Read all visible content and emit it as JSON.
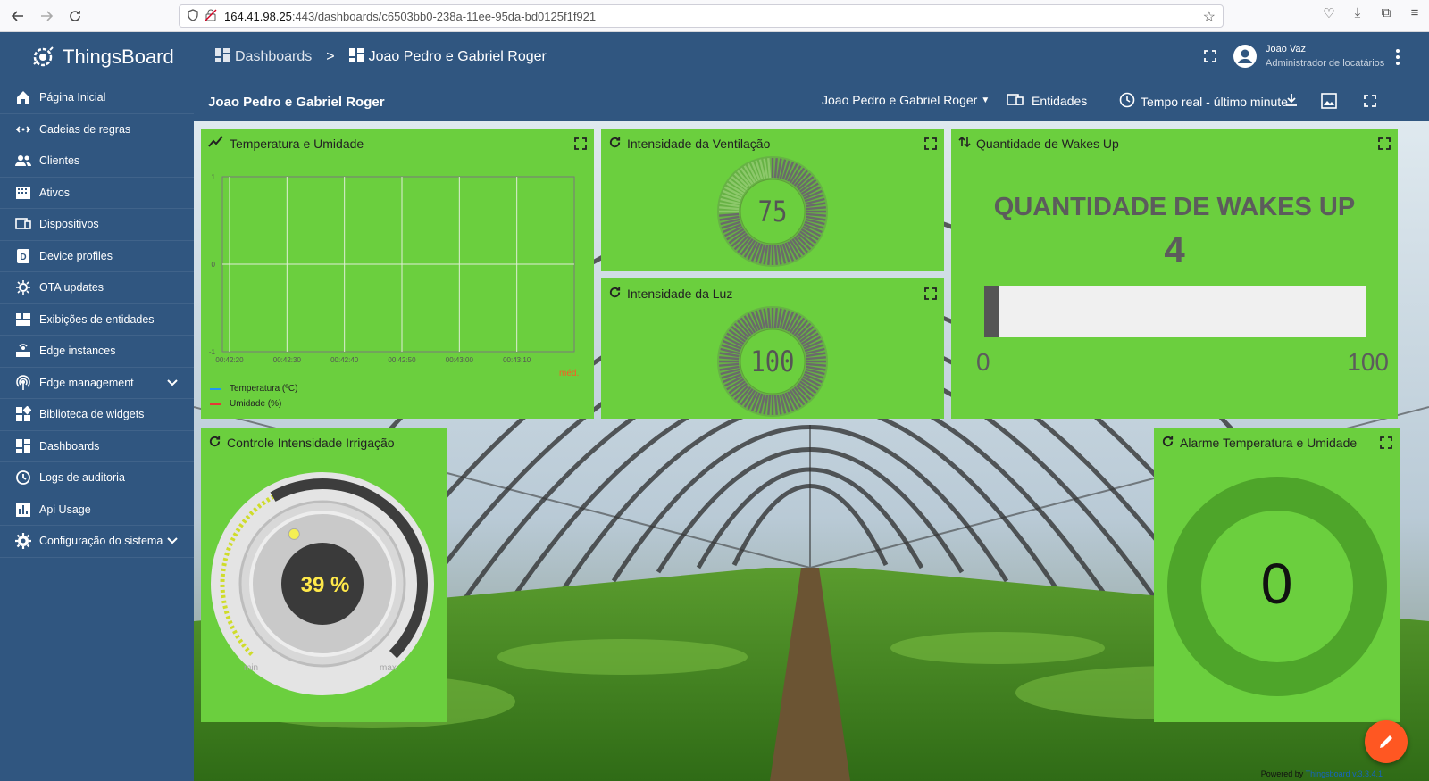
{
  "browser": {
    "url_host": "164.41.98.25",
    "url_rest": ":443/dashboards/c6503bb0-238a-11ee-95da-bd0125f1f921"
  },
  "app": {
    "name": "ThingsBoard"
  },
  "sidebar": {
    "items": [
      {
        "label": "Página Inicial",
        "icon": "home-icon"
      },
      {
        "label": "Cadeias de regras",
        "icon": "rule-chain-icon"
      },
      {
        "label": "Clientes",
        "icon": "customers-icon"
      },
      {
        "label": "Ativos",
        "icon": "assets-icon"
      },
      {
        "label": "Dispositivos",
        "icon": "devices-icon"
      },
      {
        "label": "Device profiles",
        "icon": "device-profile-icon"
      },
      {
        "label": "OTA updates",
        "icon": "ota-icon"
      },
      {
        "label": "Exibições de entidades",
        "icon": "entity-view-icon"
      },
      {
        "label": "Edge instances",
        "icon": "edge-icon"
      },
      {
        "label": "Edge management",
        "icon": "edge-management-icon"
      },
      {
        "label": "Biblioteca de widgets",
        "icon": "widgets-icon"
      },
      {
        "label": "Dashboards",
        "icon": "dashboards-icon"
      },
      {
        "label": "Logs de auditoria",
        "icon": "audit-icon"
      },
      {
        "label": "Api Usage",
        "icon": "api-usage-icon"
      },
      {
        "label": "Configuração do sistema",
        "icon": "settings-icon"
      }
    ]
  },
  "topbar": {
    "crumb1": "Dashboards",
    "separator": ">",
    "crumb2": "Joao Pedro e Gabriel Roger",
    "user_name": "Joao Vaz",
    "user_role": "Administrador de locatários"
  },
  "subbar": {
    "title": "Joao Pedro e Gabriel Roger",
    "state_select": "Joao Pedro e Gabriel Roger",
    "entities": "Entidades",
    "timewindow": "Tempo real - último minute"
  },
  "widgets": {
    "temp": {
      "title": "Temperatura e Umidade",
      "y_ticks": [
        "1",
        "0",
        "-1"
      ],
      "x_ticks": [
        "00:42:20",
        "00:42:30",
        "00:42:40",
        "00:42:50",
        "00:43:00",
        "00:43:10"
      ],
      "legend_header": "méd.",
      "legend": [
        {
          "label": "Temperatura (ºC)",
          "color": "#2196f3"
        },
        {
          "label": "Umidade (%)",
          "color": "#e53935"
        }
      ]
    },
    "vent": {
      "title": "Intensidade da Ventilação",
      "value": "75",
      "level": 0.75
    },
    "luz": {
      "title": "Intensidade da Luz",
      "value": "100",
      "level": 1.0
    },
    "wakes": {
      "title": "Quantidade de Wakes Up",
      "heading": "QUANTIDADE DE WAKES UP",
      "value": "4",
      "min": "0",
      "max": "100",
      "level": 0.04
    },
    "irrig": {
      "title": "Controle Intensidade Irrigação",
      "value": "39 %",
      "min": "min",
      "max": "max",
      "level": 0.39
    },
    "alarm": {
      "title": "Alarme Temperatura e Umidade",
      "value": "0"
    }
  },
  "footer": {
    "powered": "Powered by",
    "version": "Thingsboard v.3.3.4.1"
  }
}
